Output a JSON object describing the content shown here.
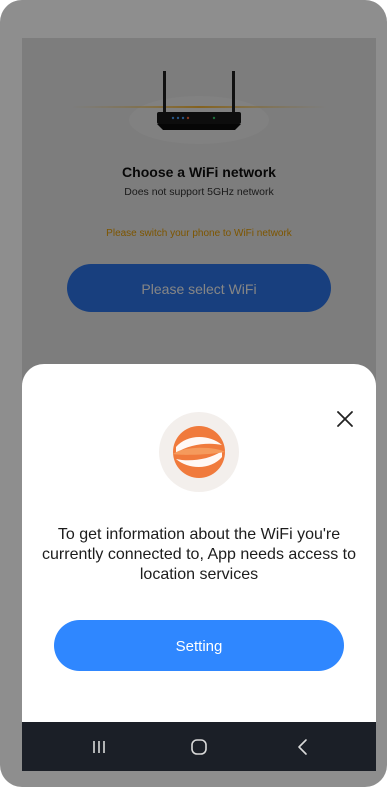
{
  "background_page": {
    "title": "Choose a WiFi network",
    "subtitle": "Does not support 5GHz network",
    "warning": "Please switch your phone to WiFi network",
    "select_button": "Please select WiFi"
  },
  "permission_sheet": {
    "message": "To get information about the WiFi you're currently connected to, App needs access to location services",
    "setting_button": "Setting",
    "close_icon": "close-icon",
    "logo_icon": "app-logo-icon"
  },
  "navigation_bar": {
    "recents_icon": "recents-icon",
    "home_icon": "home-icon",
    "back_icon": "back-icon"
  },
  "colors": {
    "accent": "#2f87ff",
    "warning": "#f0a400",
    "logo_orange": "#f07a3c"
  }
}
